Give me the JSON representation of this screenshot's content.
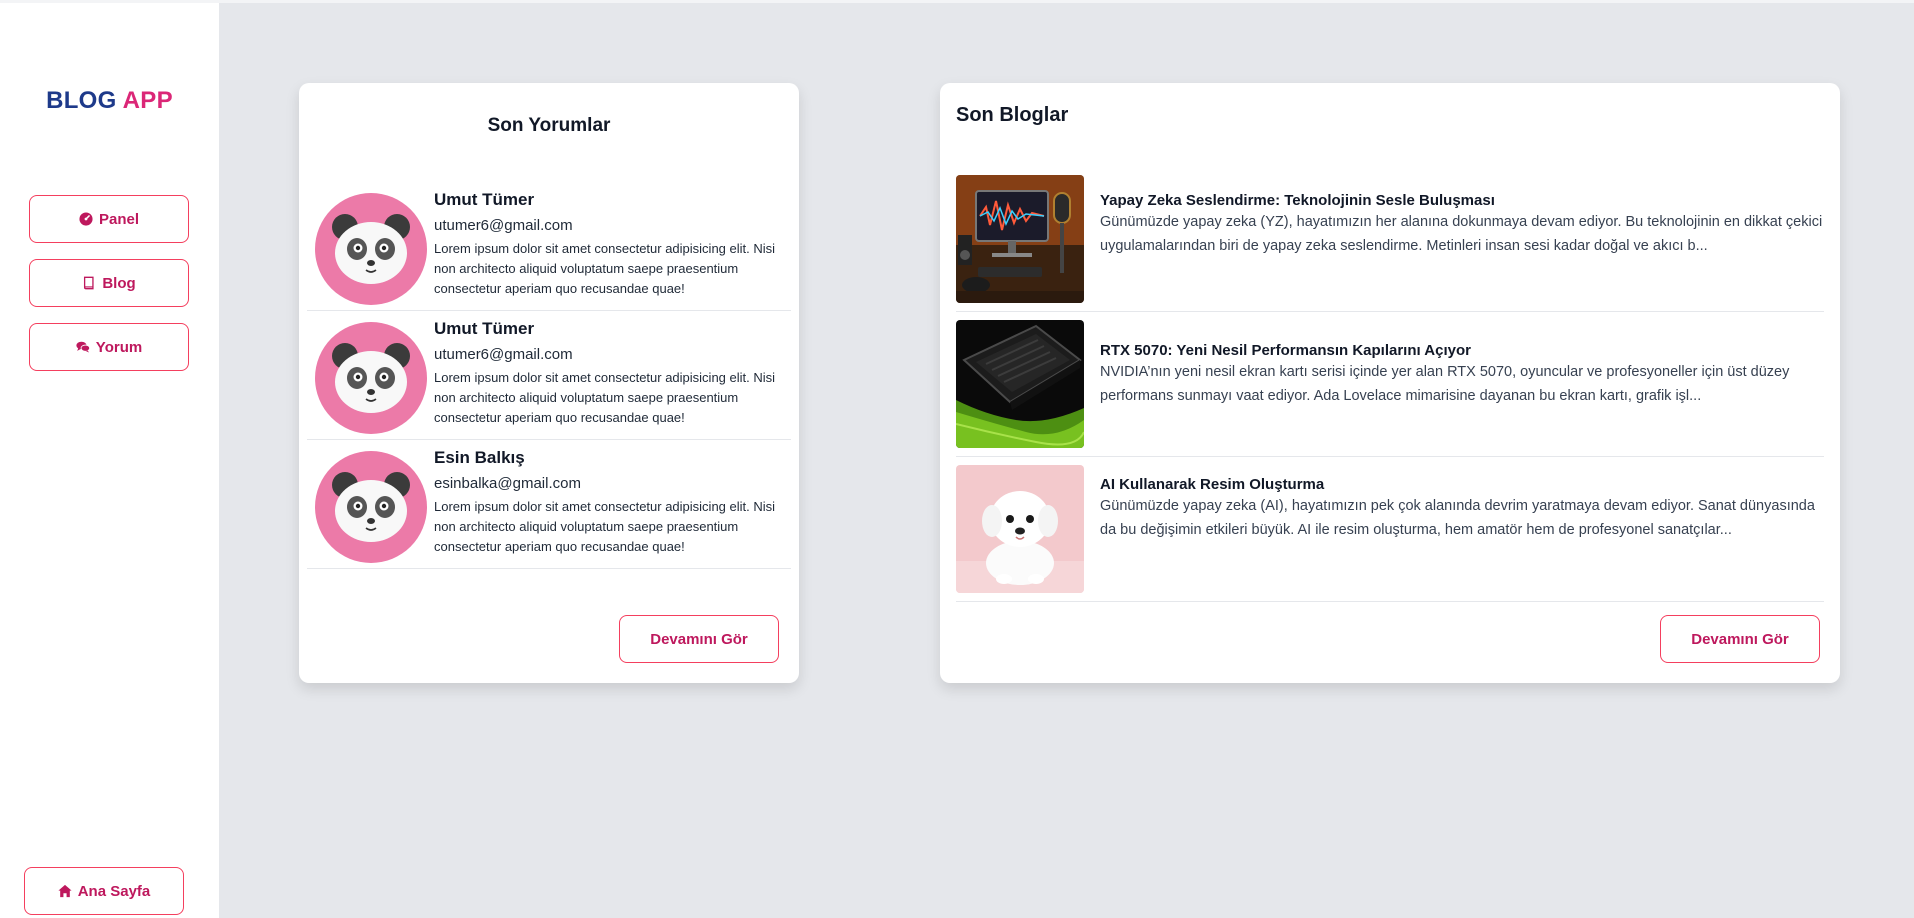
{
  "app": {
    "brand_part1": "BLOG",
    "brand_part2": "APP"
  },
  "sidebar": {
    "items": [
      {
        "label": "Panel",
        "icon": "gauge-icon"
      },
      {
        "label": "Blog",
        "icon": "book-icon"
      },
      {
        "label": "Yorum",
        "icon": "comments-icon"
      }
    ],
    "home": {
      "label": "Ana Sayfa",
      "icon": "home-icon"
    }
  },
  "comments": {
    "title": "Son Yorumlar",
    "items": [
      {
        "name": "Umut Tümer",
        "email": "utumer6@gmail.com",
        "text": "Lorem ipsum dolor sit amet consectetur adipisicing elit. Nisi non architecto aliquid voluptatum saepe praesentium consectetur aperiam quo recusandae quae!"
      },
      {
        "name": "Umut Tümer",
        "email": "utumer6@gmail.com",
        "text": "Lorem ipsum dolor sit amet consectetur adipisicing elit. Nisi non architecto aliquid voluptatum saepe praesentium consectetur aperiam quo recusandae quae!"
      },
      {
        "name": "Esin Balkış",
        "email": "esinbalka@gmail.com",
        "text": "Lorem ipsum dolor sit amet consectetur adipisicing elit. Nisi non architecto aliquid voluptatum saepe praesentium consectetur aperiam quo recusandae quae!"
      }
    ],
    "more_label": "Devamını Gör"
  },
  "blogs": {
    "title": "Son Bloglar",
    "items": [
      {
        "title": "Yapay Zeka Seslendirme: Teknolojinin Sesle Buluşması",
        "excerpt": "Günümüzde yapay zeka (YZ), hayatımızın her alanına dokunmaya devam ediyor. Bu teknolojinin en dikkat çekici uygulamalarından biri de yapay zeka seslendirme. Metinleri insan sesi kadar doğal ve akıcı b...",
        "image": "ai-voice-studio-image"
      },
      {
        "title": "RTX 5070: Yeni Nesil Performansın Kapılarını Açıyor",
        "excerpt": "NVIDIA’nın yeni nesil ekran kartı serisi içinde yer alan RTX 5070, oyuncular ve profesyoneller için üst düzey performans sunmayı vaat ediyor. Ada Lovelace mimarisine dayanan bu ekran kartı, grafik işl...",
        "image": "graphics-card-image"
      },
      {
        "title": "AI Kullanarak Resim Oluşturma",
        "excerpt": "Günümüzde yapay zeka (AI), hayatımızın pek çok alanında devrim yaratmaya devam ediyor. Sanat dünyasında da bu değişimin etkileri büyük. AI ile resim oluşturma, hem amatör hem de profesyonel sanatçılar...",
        "image": "white-puppy-image"
      }
    ],
    "more_label": "Devamını Gör"
  },
  "colors": {
    "brand_navy": "#1e3a8a",
    "brand_pink": "#db2777",
    "button_border": "#f43f5e",
    "avatar_bg": "#ec7aa8"
  }
}
